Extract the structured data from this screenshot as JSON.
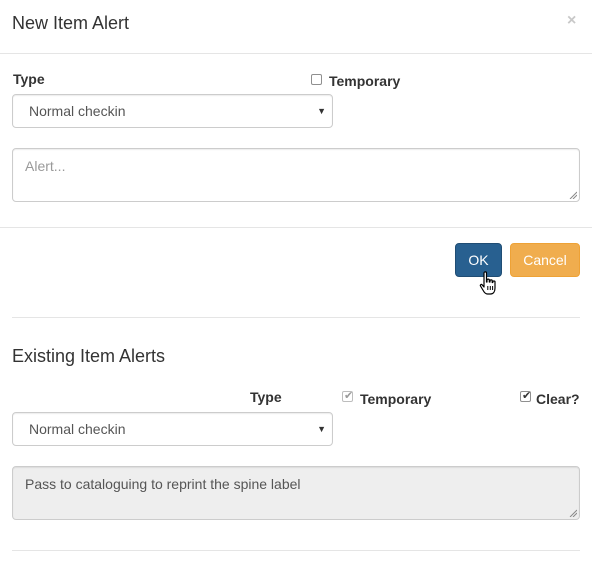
{
  "new_alert": {
    "title": "New Item Alert",
    "close_glyph": "×",
    "type_label": "Type",
    "temporary_label": "Temporary",
    "temporary_checked": false,
    "type_value": "Normal checkin",
    "alert_placeholder": "Alert...",
    "ok_label": "OK",
    "cancel_label": "Cancel"
  },
  "existing": {
    "title": "Existing Item Alerts",
    "type_label": "Type",
    "temporary_label": "Temporary",
    "temporary_checked": true,
    "clear_label": "Clear?",
    "clear_checked": true,
    "type_value": "Normal checkin",
    "alert_text": "Pass to cataloguing to reprint the spine label"
  },
  "colors": {
    "primary": "#286090",
    "warning": "#f0ad4e"
  },
  "icons": {
    "close": "close-icon",
    "dropdown": "chevron-down-icon",
    "cursor": "hand-pointer-icon"
  }
}
